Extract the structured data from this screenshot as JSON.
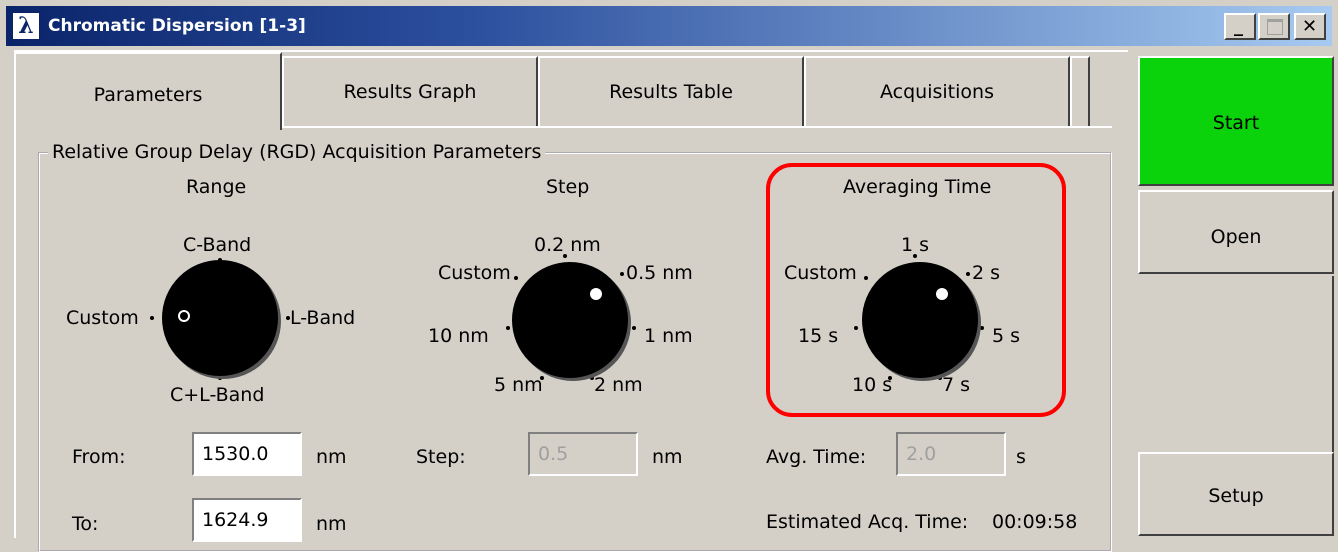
{
  "window": {
    "title": "Chromatic Dispersion [1-3]",
    "app_icon_glyph": "λ",
    "minimize_glyph": "_",
    "close_glyph": "✕"
  },
  "tabs": [
    {
      "label": "Parameters",
      "active": true
    },
    {
      "label": "Results Graph",
      "active": false
    },
    {
      "label": "Results Table",
      "active": false
    },
    {
      "label": "Acquisitions",
      "active": false
    }
  ],
  "group": {
    "label": "Relative Group Delay (RGD) Acquisition Parameters"
  },
  "range": {
    "title": "Range",
    "options": [
      "C-Band",
      "L-Band",
      "C+L-Band",
      "Custom"
    ],
    "selected": "Custom"
  },
  "step": {
    "title": "Step",
    "options": [
      "0.2 nm",
      "0.5 nm",
      "1 nm",
      "2 nm",
      "5 nm",
      "10 nm",
      "Custom"
    ],
    "selected": "0.5 nm"
  },
  "averaging": {
    "title": "Averaging Time",
    "options": [
      "1 s",
      "2 s",
      "5 s",
      "7 s",
      "10 s",
      "15 s",
      "Custom"
    ],
    "selected": "2 s"
  },
  "fields": {
    "from_label": "From:",
    "from_value": "1530.0",
    "from_unit": "nm",
    "to_label": "To:",
    "to_value": "1624.9",
    "to_unit": "nm",
    "step_label": "Step:",
    "step_value": "0.5",
    "step_unit": "nm",
    "avg_label": "Avg. Time:",
    "avg_value": "2.0",
    "avg_unit": "s",
    "est_label": "Estimated Acq. Time:",
    "est_value": "00:09:58"
  },
  "side_buttons": {
    "start": "Start",
    "open": "Open",
    "setup": "Setup"
  },
  "colors": {
    "start_green": "#0bd30b",
    "highlight_red": "#ff0000",
    "title_blue": "#0a246a"
  }
}
